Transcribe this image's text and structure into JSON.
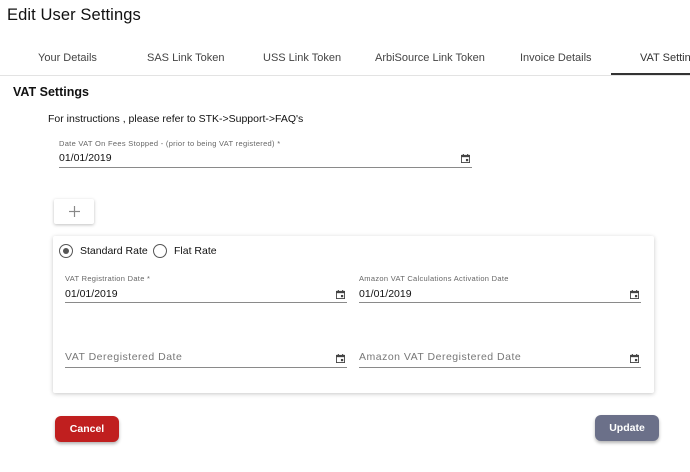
{
  "page_title": "Edit User Settings",
  "tabs": [
    {
      "label": "Your Details"
    },
    {
      "label": "SAS Link Token"
    },
    {
      "label": "USS Link Token"
    },
    {
      "label": "ArbiSource Link Token"
    },
    {
      "label": "Invoice Details"
    },
    {
      "label": "VAT Settings",
      "active": true
    }
  ],
  "vat": {
    "section_title": "VAT Settings",
    "instructions": "For instructions , please refer to STK->Support->FAQ's",
    "fees_stopped": {
      "label": "Date VAT On Fees Stopped - (prior to being VAT registered) *",
      "value": "01/01/2019"
    },
    "add_icon": "plus-icon",
    "rate_options": [
      {
        "label": "Standard Rate",
        "checked": true
      },
      {
        "label": "Flat Rate",
        "checked": false
      }
    ],
    "registration_date": {
      "label": "VAT Registration Date *",
      "value": "01/01/2019"
    },
    "amazon_activation": {
      "label": "Amazon VAT Calculations Activation Date",
      "value": "01/01/2019"
    },
    "deregistered_date": {
      "placeholder": "VAT Deregistered Date"
    },
    "amazon_deregistered": {
      "placeholder": "Amazon VAT Deregistered Date"
    }
  },
  "actions": {
    "cancel_label": "Cancel",
    "update_label": "Update",
    "cancel_color": "#c01f1f",
    "update_color": "#6b7089"
  }
}
